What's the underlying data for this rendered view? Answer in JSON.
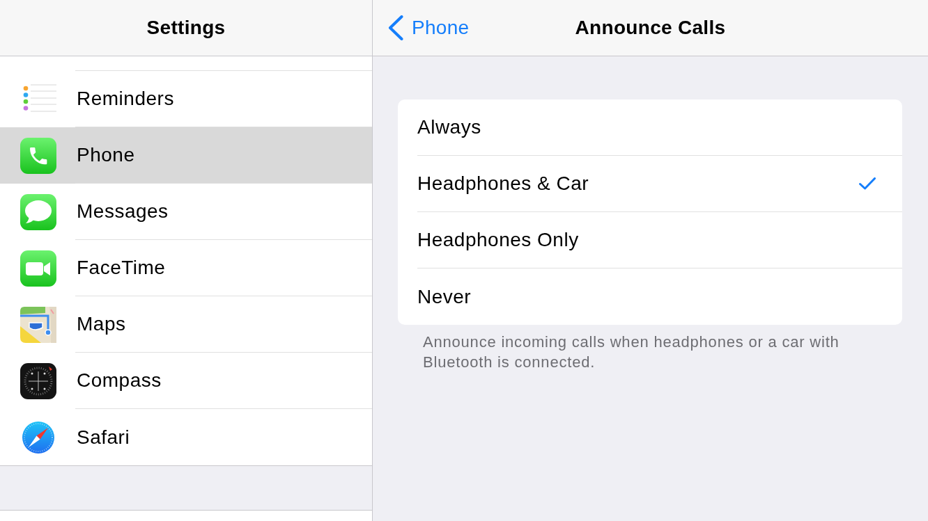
{
  "sidebar": {
    "title": "Settings",
    "items": [
      {
        "label": "Reminders",
        "kind": "reminders",
        "selected": false
      },
      {
        "label": "Phone",
        "kind": "phone",
        "selected": true
      },
      {
        "label": "Messages",
        "kind": "messages",
        "selected": false
      },
      {
        "label": "FaceTime",
        "kind": "facetime",
        "selected": false
      },
      {
        "label": "Maps",
        "kind": "maps",
        "selected": false
      },
      {
        "label": "Compass",
        "kind": "compass",
        "selected": false
      },
      {
        "label": "Safari",
        "kind": "safari",
        "selected": false
      }
    ]
  },
  "detail": {
    "back_button": "Phone",
    "title": "Announce Calls",
    "options": [
      {
        "label": "Always",
        "selected": false
      },
      {
        "label": "Headphones & Car",
        "selected": true
      },
      {
        "label": "Headphones Only",
        "selected": false
      },
      {
        "label": "Never",
        "selected": false
      }
    ],
    "footer": "Announce incoming calls when headphones or a car with Bluetooth is connected."
  }
}
